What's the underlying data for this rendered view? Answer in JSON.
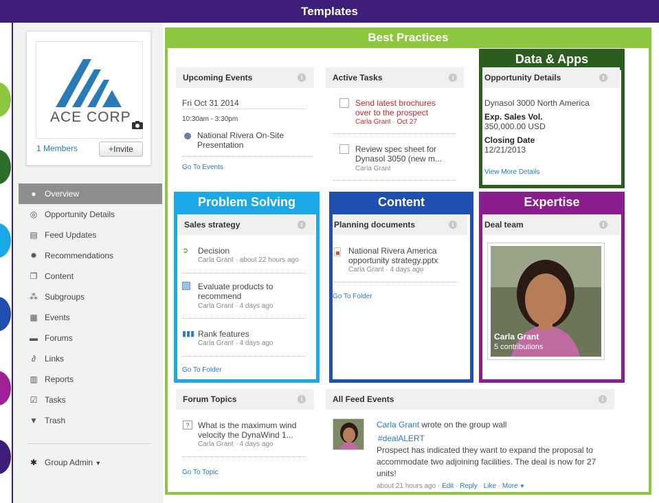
{
  "banner": {
    "title": "Templates"
  },
  "profile": {
    "company_name": "ACE CORP",
    "members_label": "1 Members",
    "invite_label": "Invite"
  },
  "nav": {
    "items": [
      {
        "label": "Overview",
        "icon": "info-icon"
      },
      {
        "label": "Opportunity Details",
        "icon": "dollar-icon"
      },
      {
        "label": "Feed Updates",
        "icon": "feed-icon"
      },
      {
        "label": "Recommendations",
        "icon": "lightbulb-icon"
      },
      {
        "label": "Content",
        "icon": "document-icon"
      },
      {
        "label": "Subgroups",
        "icon": "subgroups-icon"
      },
      {
        "label": "Events",
        "icon": "calendar-icon"
      },
      {
        "label": "Forums",
        "icon": "forum-icon"
      },
      {
        "label": "Links",
        "icon": "link-icon"
      },
      {
        "label": "Reports",
        "icon": "report-icon"
      },
      {
        "label": "Tasks",
        "icon": "checkbox-icon"
      },
      {
        "label": "Trash",
        "icon": "trash-icon"
      }
    ],
    "group_admin": "Group Admin"
  },
  "categories": {
    "best_practices": "Best Practices",
    "data_apps": "Data & Apps",
    "problem_solving": "Problem Solving",
    "content": "Content",
    "expertise": "Expertise"
  },
  "upcoming_events": {
    "title": "Upcoming Events",
    "date": "Fri Oct 31 2014",
    "time": "10:30am - 3:30pm",
    "event_line1": "National Rivera On-Site",
    "event_line2": "Presentation",
    "link": "Go To Events"
  },
  "active_tasks": {
    "title": "Active Tasks",
    "task1_line1": "Send latest brochures",
    "task1_line2": "over to the prospect",
    "task1_meta": "Carla Grant · Oct 27",
    "task2_line1": "Review spec sheet for",
    "task2_line2": "Dynasol 3050 (new m...",
    "task2_meta": "Carla Grant"
  },
  "opportunity": {
    "title": "Opportunity Details",
    "name": "Dynasol 3000 North America",
    "sales_label": "Exp. Sales Vol.",
    "sales_value": "350,000.00 USD",
    "close_label": "Closing Date",
    "close_value": "12/21/2013",
    "link": "View More Details"
  },
  "sales_strategy": {
    "title": "Sales strategy",
    "item1": "Decision",
    "item1_meta": "Carla Grant · about 22 hours ago",
    "item2_line1": "Evaluate products to",
    "item2_line2": "recommend",
    "item2_meta": "Carla Grant · 4 days ago",
    "item3": "Rank features",
    "item3_meta": "Carla Grant · 4 days ago",
    "link": "Go To Folder"
  },
  "planning_docs": {
    "title": "Planning documents",
    "doc_line1": "National Rivera America",
    "doc_line2": "opportunity strategy.pptx",
    "doc_meta": "Carla Grant · 4 days ago",
    "link": "Go To Folder"
  },
  "deal_team": {
    "title": "Deal team",
    "person_name": "Carla Grant",
    "contributions": "5 contributions"
  },
  "forum_topics": {
    "title": "Forum Topics",
    "topic_line1": "What is the maximum wind",
    "topic_line2": "velocity the DynaWind 1...",
    "topic_meta": "Carla Grant · 4 days ago",
    "link": "Go To Topic"
  },
  "feed_events": {
    "title": "All Feed Events",
    "author": "Carla Grant",
    "action": " wrote on the group wall",
    "hashtag": "#dealALERT",
    "msg_line1": "Prospect has indicated they want to expand the proposal to",
    "msg_line2": "accommodate two adjoining facilities. The deal is now for 27",
    "msg_line3": "units!",
    "time": "about 21 hours ago",
    "actions": [
      "Edit",
      "Reply",
      "Like",
      "More"
    ]
  },
  "colors": {
    "banner": "#3d1e7a",
    "best_practices": "#8dc63f",
    "data_apps": "#2b5e1e",
    "problem_solving": "#1aa9e6",
    "content": "#1f4fb0",
    "expertise": "#8a1d8f",
    "link": "#2a7ab8"
  }
}
